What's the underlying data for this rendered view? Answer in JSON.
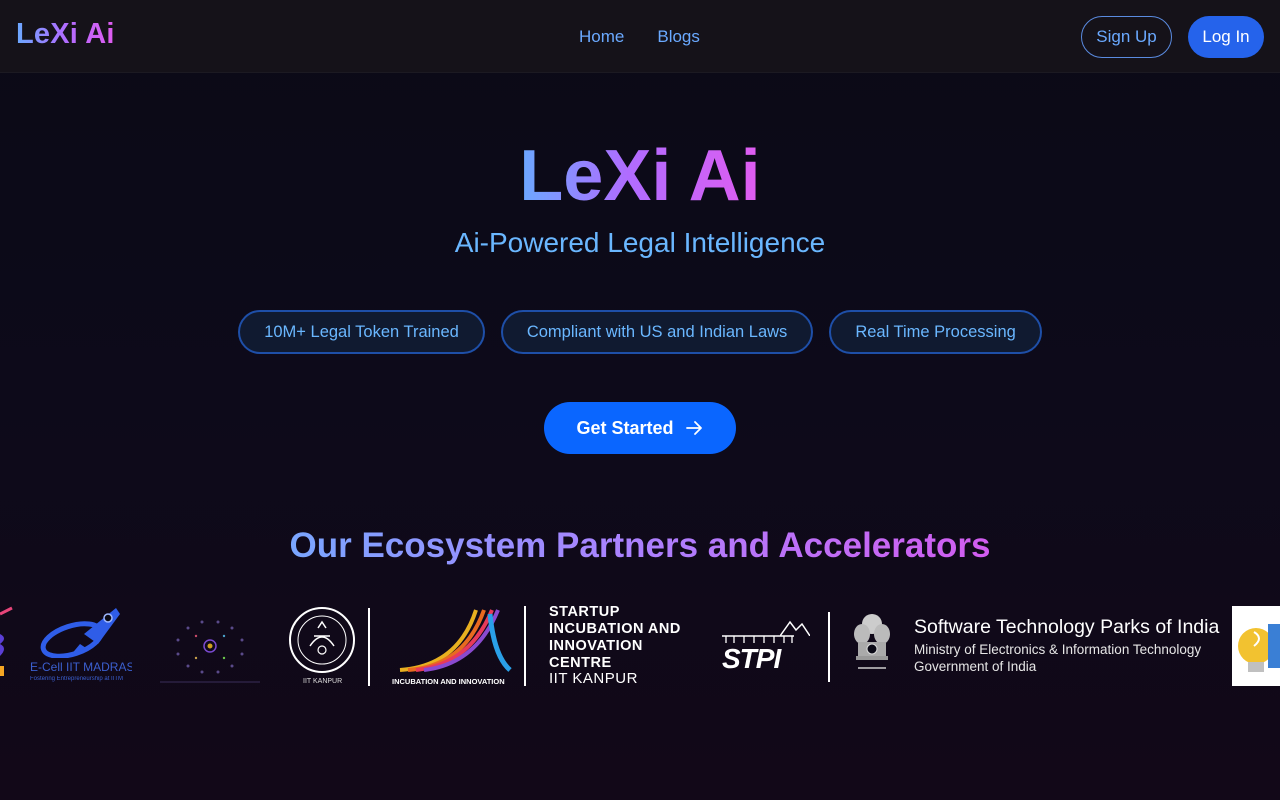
{
  "nav": {
    "brand": "LeXi Ai",
    "links": [
      "Home",
      "Blogs"
    ],
    "signup_label": "Sign Up",
    "login_label": "Log In"
  },
  "hero": {
    "title": "LeXi Ai",
    "subtitle": "Ai-Powered Legal Intelligence",
    "features": [
      "10M+ Legal Token Trained",
      "Compliant with US and Indian Laws",
      "Real Time Processing"
    ],
    "cta_label": "Get Started"
  },
  "partners": {
    "title": "Our Ecosystem Partners and Accelerators",
    "ecell": {
      "name": "E-Cell IIT MADRAS",
      "tagline": "Fostering Entrepreneurship at IITM"
    },
    "iitk_label": "IIT KANPUR",
    "incubation_label": "INCUBATION AND INNOVATION",
    "siic": {
      "lines": [
        "STARTUP",
        "INCUBATION AND",
        "INNOVATION",
        "CENTRE"
      ],
      "sub": "IIT KANPUR"
    },
    "stpi": {
      "short": "STPI",
      "title": "Software Technology Parks of India",
      "sub1": "Ministry of Electronics & Information Technology",
      "sub2": "Government of India"
    }
  },
  "colors": {
    "background": "#0b0a16",
    "accent_blue": "#2563eb",
    "cta_blue": "#0a66ff",
    "text_blue": "#6ab7ff",
    "gradient_purple": "#b06cff",
    "gradient_pink": "#e05cf0"
  },
  "icons": [
    "arrow-right-icon",
    "rocket-icon",
    "neural-brain-icon",
    "iit-seal-icon",
    "incubation-arcs-icon",
    "ashoka-emblem-icon",
    "bulb-icon"
  ]
}
